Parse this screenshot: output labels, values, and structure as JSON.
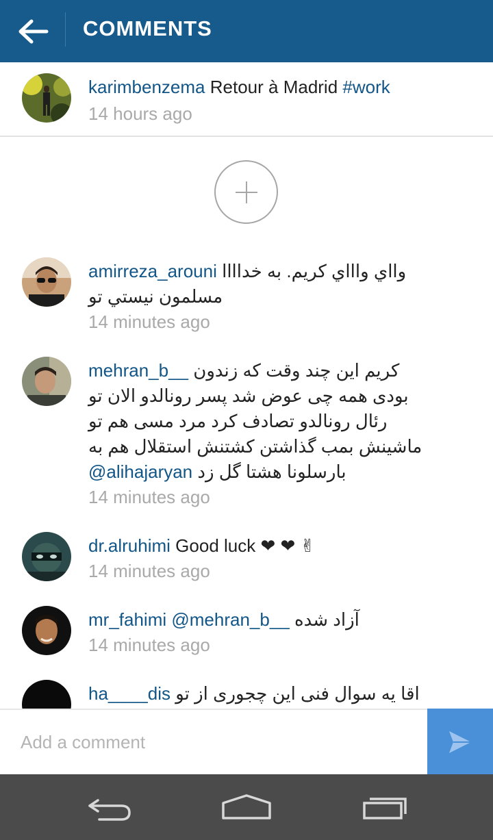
{
  "header": {
    "title": "COMMENTS",
    "back_icon": "arrow-left-icon",
    "background": "#175b8d"
  },
  "caption": {
    "username": "karimbenzema",
    "text": "Retour à Madrid",
    "hashtag": "#work",
    "time": "14 hours ago"
  },
  "load_more_icon": "plus-circle-icon",
  "comments": [
    {
      "username": "amirreza_arouni",
      "lines": [
        "وااي واااي كريم. به خداااا",
        "مسلمون نيستي تو"
      ],
      "time": "14 minutes ago"
    },
    {
      "username": "mehran_b__",
      "lines": [
        "کریم این چند وقت که زندون",
        "بودی همه چی عوض شد پسر رونالدو الان تو",
        "رئال رونالدو تصادف کرد مرد مسی هم تو",
        "ماشینش بمب گذاشتن کشتنش استقلال هم به"
      ],
      "last_line_mention": "@alihajaryan",
      "last_line_text": "بارسلونا هشتا گل زد",
      "time": "14 minutes ago"
    },
    {
      "username": "dr.alruhimi",
      "text": "Good luck ❤ ❤ ✌",
      "time": "14 minutes ago"
    },
    {
      "username": "mr_fahimi",
      "mention": "@mehran_b__",
      "text": "آزاد شده",
      "time": "14 minutes ago"
    },
    {
      "username": "ha____dis",
      "text": "اقا یه سوال فنی این چجوری از تو"
    }
  ],
  "composer": {
    "placeholder": "Add a comment",
    "send_icon": "send-arrow-icon",
    "send_color": "#4a90d9"
  },
  "navbar": {
    "icons": [
      "back-nav-icon",
      "home-nav-icon",
      "recents-nav-icon"
    ]
  }
}
